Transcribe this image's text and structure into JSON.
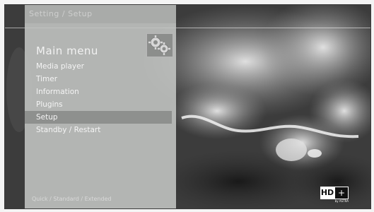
{
  "header": {
    "text": "Setting / Setup"
  },
  "menu": {
    "title": "Main menu",
    "icon": "gear-icon",
    "items": [
      {
        "label": "Media player",
        "selected": false
      },
      {
        "label": "Timer",
        "selected": false
      },
      {
        "label": "Information",
        "selected": false
      },
      {
        "label": "Plugins",
        "selected": false
      },
      {
        "label": "Setup",
        "selected": true
      },
      {
        "label": "Standby / Restart",
        "selected": false
      }
    ]
  },
  "footer": {
    "text": "Quick / Standard / Extended"
  },
  "logo": {
    "left": "HD",
    "right": "+",
    "sub": "by ASTRA"
  },
  "colors": {
    "panel": "#c4c6c4",
    "selected": "#8e908e",
    "background": "#2a2a2a"
  }
}
